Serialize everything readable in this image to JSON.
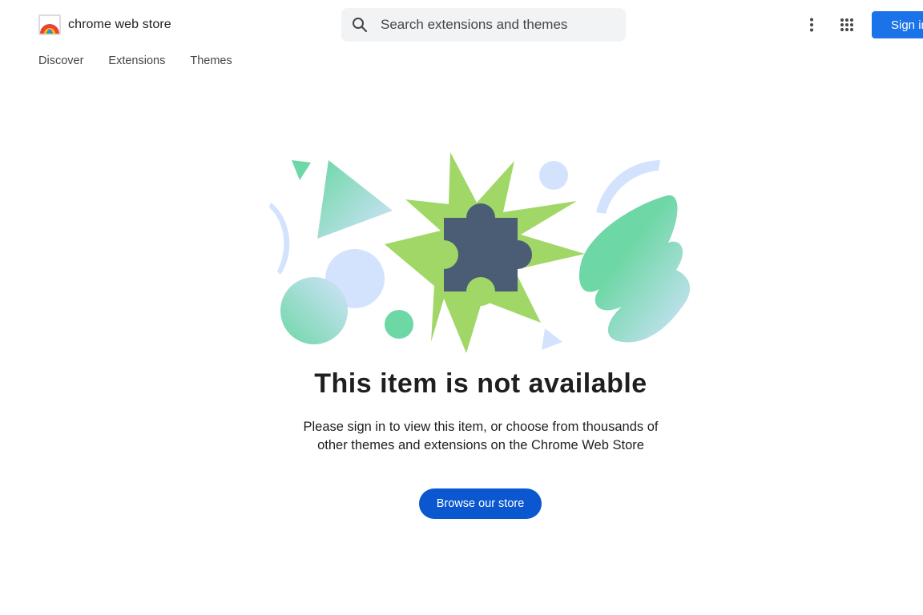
{
  "header": {
    "store_name": "chrome web store",
    "search_placeholder": "Search extensions and themes",
    "sign_in_label": "Sign in",
    "icons": [
      "chrome-web-store-logo",
      "search-icon",
      "more-vert-icon",
      "apps-grid-icon"
    ]
  },
  "nav": {
    "items": [
      "Discover",
      "Extensions",
      "Themes"
    ]
  },
  "message": {
    "title": "This item is not available",
    "body": "Please sign in to view this item, or choose from thousands of other themes and extensions on the Chrome Web Store",
    "button_label": "Browse our store"
  },
  "colors": {
    "primary_button": "#0b57d0",
    "sign_in_button": "#1a73e8",
    "search_bg": "#f1f3f4",
    "starburst_green": "#a0d767",
    "puzzle_slate": "#4a5d74",
    "light_blue": "#d3e3fd",
    "mint_green": "#6dd7a5"
  }
}
